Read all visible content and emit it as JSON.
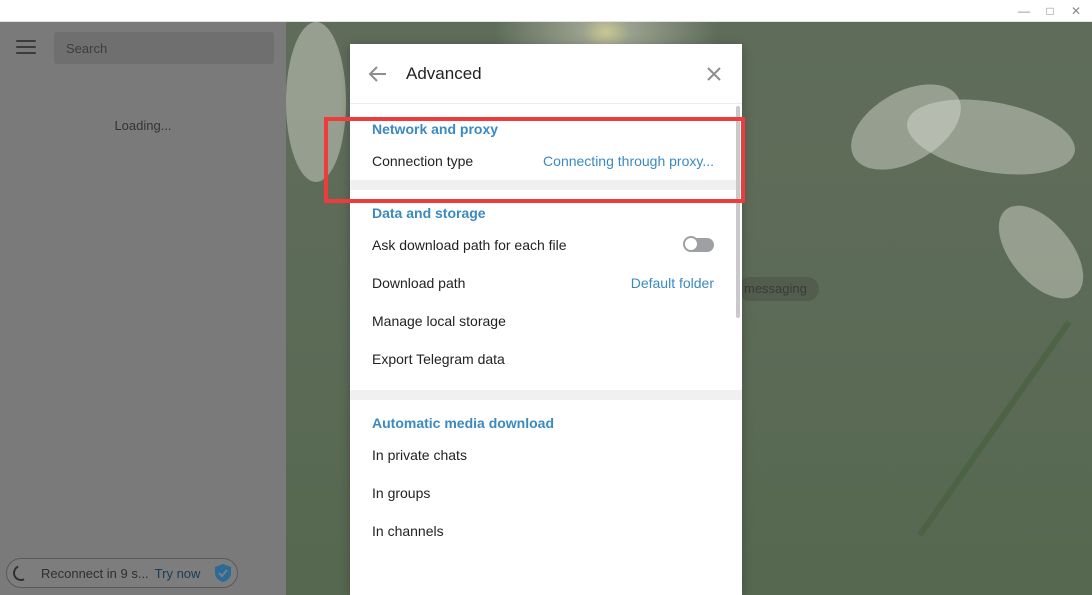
{
  "window": {
    "minimize_glyph": "—",
    "maximize_glyph": "□",
    "close_glyph": "✕"
  },
  "sidebar": {
    "search_placeholder": "Search",
    "loading_text": "Loading...",
    "reconnect_text": "Reconnect in 9 s...",
    "try_now_label": "Try now"
  },
  "chat": {
    "service_pill": "messaging"
  },
  "modal": {
    "title": "Advanced",
    "sections": [
      {
        "title": "Network and proxy",
        "rows": [
          {
            "label": "Connection type",
            "value": "Connecting through proxy..."
          }
        ]
      },
      {
        "title": "Data and storage",
        "rows": [
          {
            "label": "Ask download path for each file",
            "toggle": false
          },
          {
            "label": "Download path",
            "value": "Default folder"
          },
          {
            "label": "Manage local storage"
          },
          {
            "label": "Export Telegram data"
          }
        ]
      },
      {
        "title": "Automatic media download",
        "rows": [
          {
            "label": "In private chats"
          },
          {
            "label": "In groups"
          },
          {
            "label": "In channels"
          }
        ]
      }
    ]
  },
  "colors": {
    "accent": "#3a8ac0",
    "highlight": "#ee3b3b"
  }
}
